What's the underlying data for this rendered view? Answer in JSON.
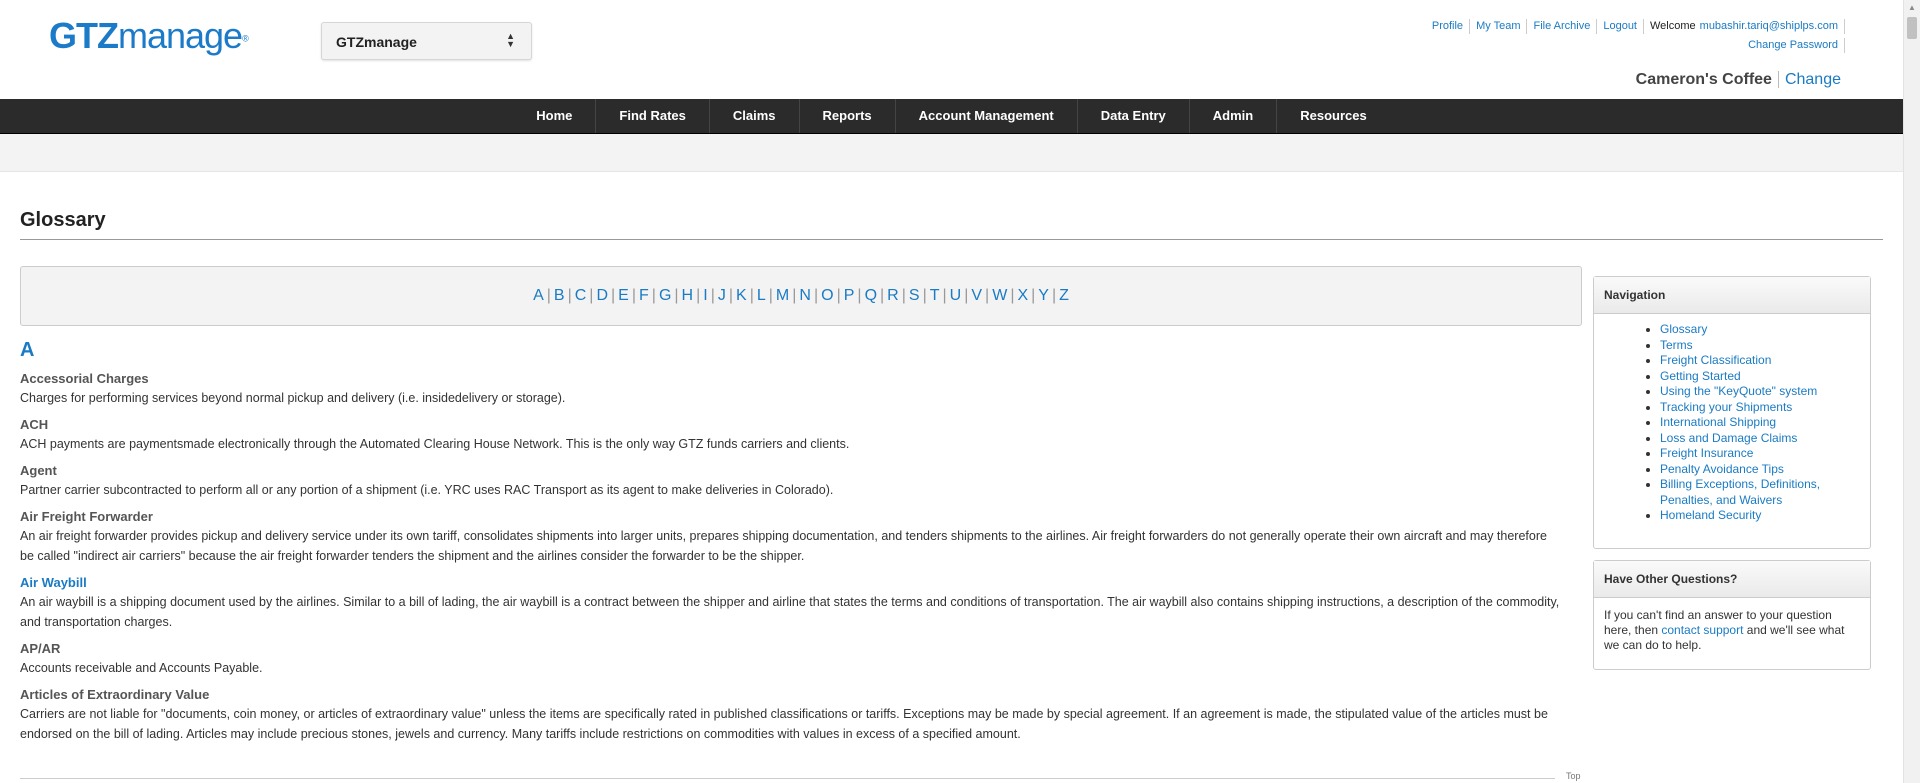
{
  "header": {
    "logo_brand": "GTZ",
    "logo_product": "manage",
    "logo_mark": "®",
    "org_select_value": "GTZmanage",
    "links": {
      "profile": "Profile",
      "my_team": "My Team",
      "file_archive": "File Archive",
      "logout": "Logout"
    },
    "welcome_label": "Welcome",
    "user_email": "mubashir.tariq@shiplps.com",
    "change_password": "Change Password",
    "company_name": "Cameron's Coffee",
    "company_change": "Change"
  },
  "nav": {
    "items": [
      "Home",
      "Find Rates",
      "Claims",
      "Reports",
      "Account Management",
      "Data Entry",
      "Admin",
      "Resources"
    ]
  },
  "page": {
    "title": "Glossary",
    "letters": [
      "A",
      "B",
      "C",
      "D",
      "E",
      "F",
      "G",
      "H",
      "I",
      "J",
      "K",
      "L",
      "M",
      "N",
      "O",
      "P",
      "Q",
      "R",
      "S",
      "T",
      "U",
      "V",
      "W",
      "X",
      "Y",
      "Z"
    ],
    "section_letter": "A",
    "terms": [
      {
        "term": "Accessorial Charges",
        "def": "Charges for performing services beyond normal pickup and delivery (i.e. insidedelivery or storage)."
      },
      {
        "term": "ACH",
        "def": "ACH payments are paymentsmade electronically through the Automated Clearing House Network. This is the only way GTZ funds carriers and clients."
      },
      {
        "term": "Agent",
        "def": "Partner carrier subcontracted to perform all or any portion of a shipment (i.e. YRC uses RAC Transport as its agent to make deliveries in Colorado)."
      },
      {
        "term": "Air Freight Forwarder",
        "def": "An air freight forwarder provides pickup and delivery service under its own tariff, consolidates shipments into larger units, prepares shipping documentation, and tenders shipments to the airlines. Air freight forwarders do not generally operate their own aircraft and may therefore be called \"indirect air carriers\" because the air freight forwarder tenders the shipment and the airlines consider the forwarder to be the shipper."
      },
      {
        "term": "Air Waybill",
        "def": "An air waybill is a shipping document used by the airlines. Similar to a bill of lading, the air waybill is a contract between the shipper and airline that states the terms and conditions of transportation. The air waybill also contains shipping instructions, a description of the commodity, and transportation charges."
      },
      {
        "term": "AP/AR",
        "def": "Accounts receivable and Accounts Payable."
      },
      {
        "term": "Articles of Extraordinary Value",
        "def": "Carriers are not liable for \"documents, coin money, or articles of extraordinary value\" unless the items are specifically rated in published classifications or tariffs. Exceptions may be made by special agreement. If an agreement is made, the stipulated value of the articles must be endorsed on the bill of lading. Articles may include precious stones, jewels and currency. Many tariffs include restrictions on commodities with values in excess of a specified amount."
      }
    ],
    "top_link": "Top"
  },
  "sidebar": {
    "nav_title": "Navigation",
    "nav_items": [
      "Glossary",
      "Terms",
      "Freight Classification",
      "Getting Started",
      "Using the \"KeyQuote\" system",
      "Tracking your Shipments",
      "International Shipping",
      "Loss and Damage Claims",
      "Freight Insurance",
      "Penalty Avoidance Tips",
      "Billing Exceptions, Definitions, Penalties, and Waivers",
      "Homeland Security"
    ],
    "questions_title": "Have Other Questions?",
    "questions_pre": "If you can't find an answer to your question here, then ",
    "questions_link": "contact support",
    "questions_post": " and we'll see what we can do to help."
  },
  "colors": {
    "accent": "#1a7bc4",
    "navbar": "#2b2b2b",
    "logo": "#1c7bc8"
  }
}
